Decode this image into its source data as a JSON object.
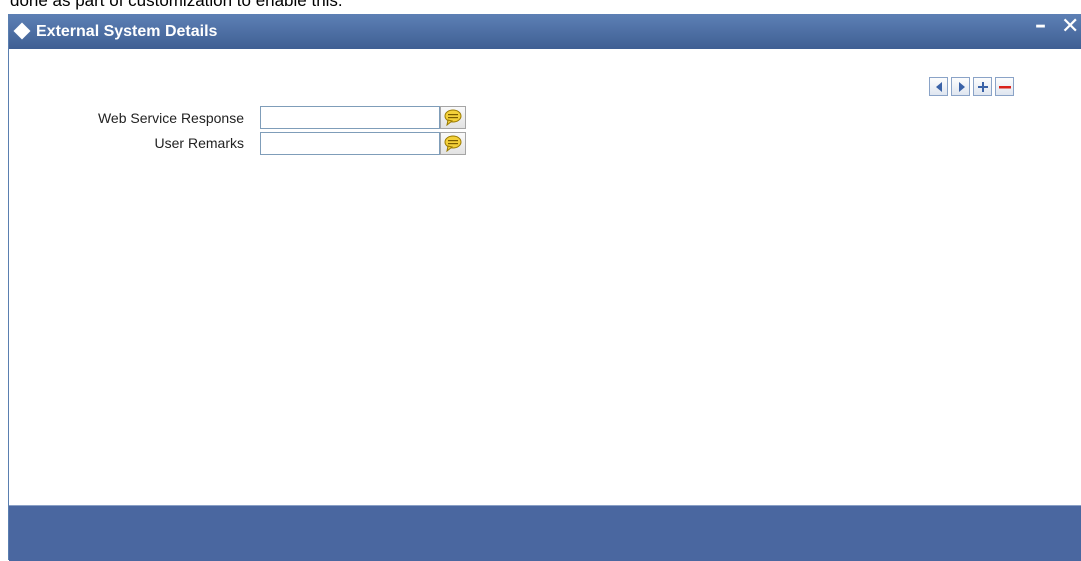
{
  "document": {
    "fragment_text": "done as part of customization to enable this."
  },
  "window": {
    "title": "External System Details",
    "minimize_label": "–",
    "close_label": "✕"
  },
  "toolbar": {
    "icons": [
      "previous-record-icon",
      "next-record-icon",
      "add-row-icon",
      "delete-row-icon"
    ]
  },
  "form": {
    "fields": [
      {
        "label": "Web Service Response",
        "value": ""
      },
      {
        "label": "User Remarks",
        "value": ""
      }
    ]
  },
  "colors": {
    "titlebar": "#4a6aa0",
    "footer": "#4a67a0",
    "nav_arrow": "#3a62a7",
    "delete": "#d9221b",
    "comment_icon": "#e8c000"
  }
}
